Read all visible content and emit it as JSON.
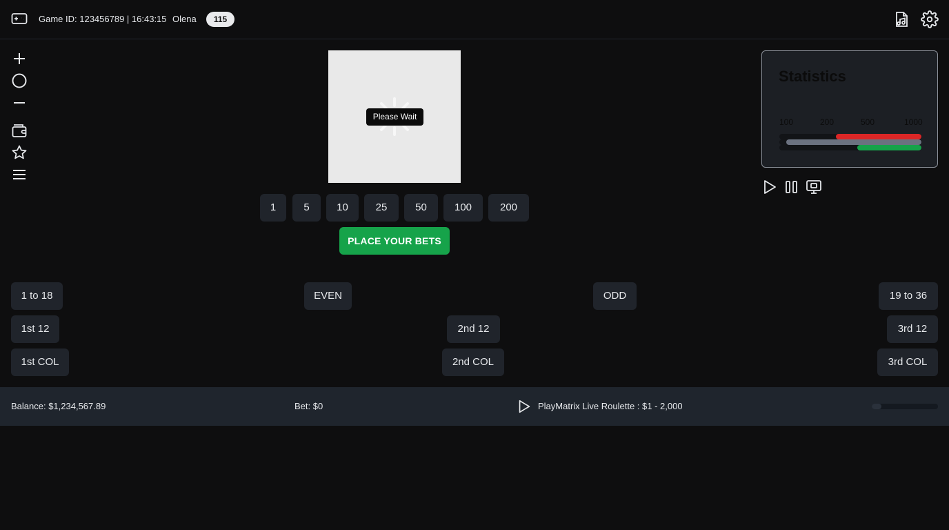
{
  "header": {
    "game_info": "Game ID: 123456789 | 16:43:15",
    "user_name": "Olena",
    "user_badge": "115",
    "icons": [
      "gamepad-icon",
      "headset-music-icon",
      "gear-icon"
    ]
  },
  "toolbar": {
    "icons": [
      "plus-icon",
      "circle-icon",
      "minus-icon",
      "wallet-icon",
      "star-icon",
      "menu-icon"
    ]
  },
  "video": {
    "wait_label": "Please Wait"
  },
  "chips": [
    "1",
    "5",
    "10",
    "25",
    "50",
    "100",
    "200"
  ],
  "place_bets_label": "PLACE YOUR BETS",
  "statistics": {
    "title": "Statistics",
    "ticks": [
      "100",
      "200",
      "500",
      "1000"
    ],
    "bars": [
      {
        "color": "#dc2626",
        "from": 0.4,
        "to": 1.0
      },
      {
        "color": "#6b7280",
        "from": 0.05,
        "to": 1.0
      },
      {
        "color": "#16a34a",
        "from": 0.55,
        "to": 1.0
      }
    ]
  },
  "media_controls": [
    "play-icon",
    "pause-icon",
    "screen-icon"
  ],
  "bets": {
    "row1": [
      "1 to 18",
      "EVEN",
      "ODD",
      "19 to 36"
    ],
    "row2": [
      "1st 12",
      "2nd 12",
      "3rd 12"
    ],
    "row3": [
      "1st COL",
      "2nd COL",
      "3rd COL"
    ]
  },
  "footer": {
    "balance": "Balance: $1,234,567.89",
    "bet": "Bet: $0",
    "table_info": "PlayMatrix Live Roulette : $1 - 2,000",
    "progress": 0.15
  },
  "colors": {
    "background": "#0e0e0f",
    "panel": "#20242b",
    "accent_green": "#16a34a",
    "accent_red": "#dc2626"
  }
}
